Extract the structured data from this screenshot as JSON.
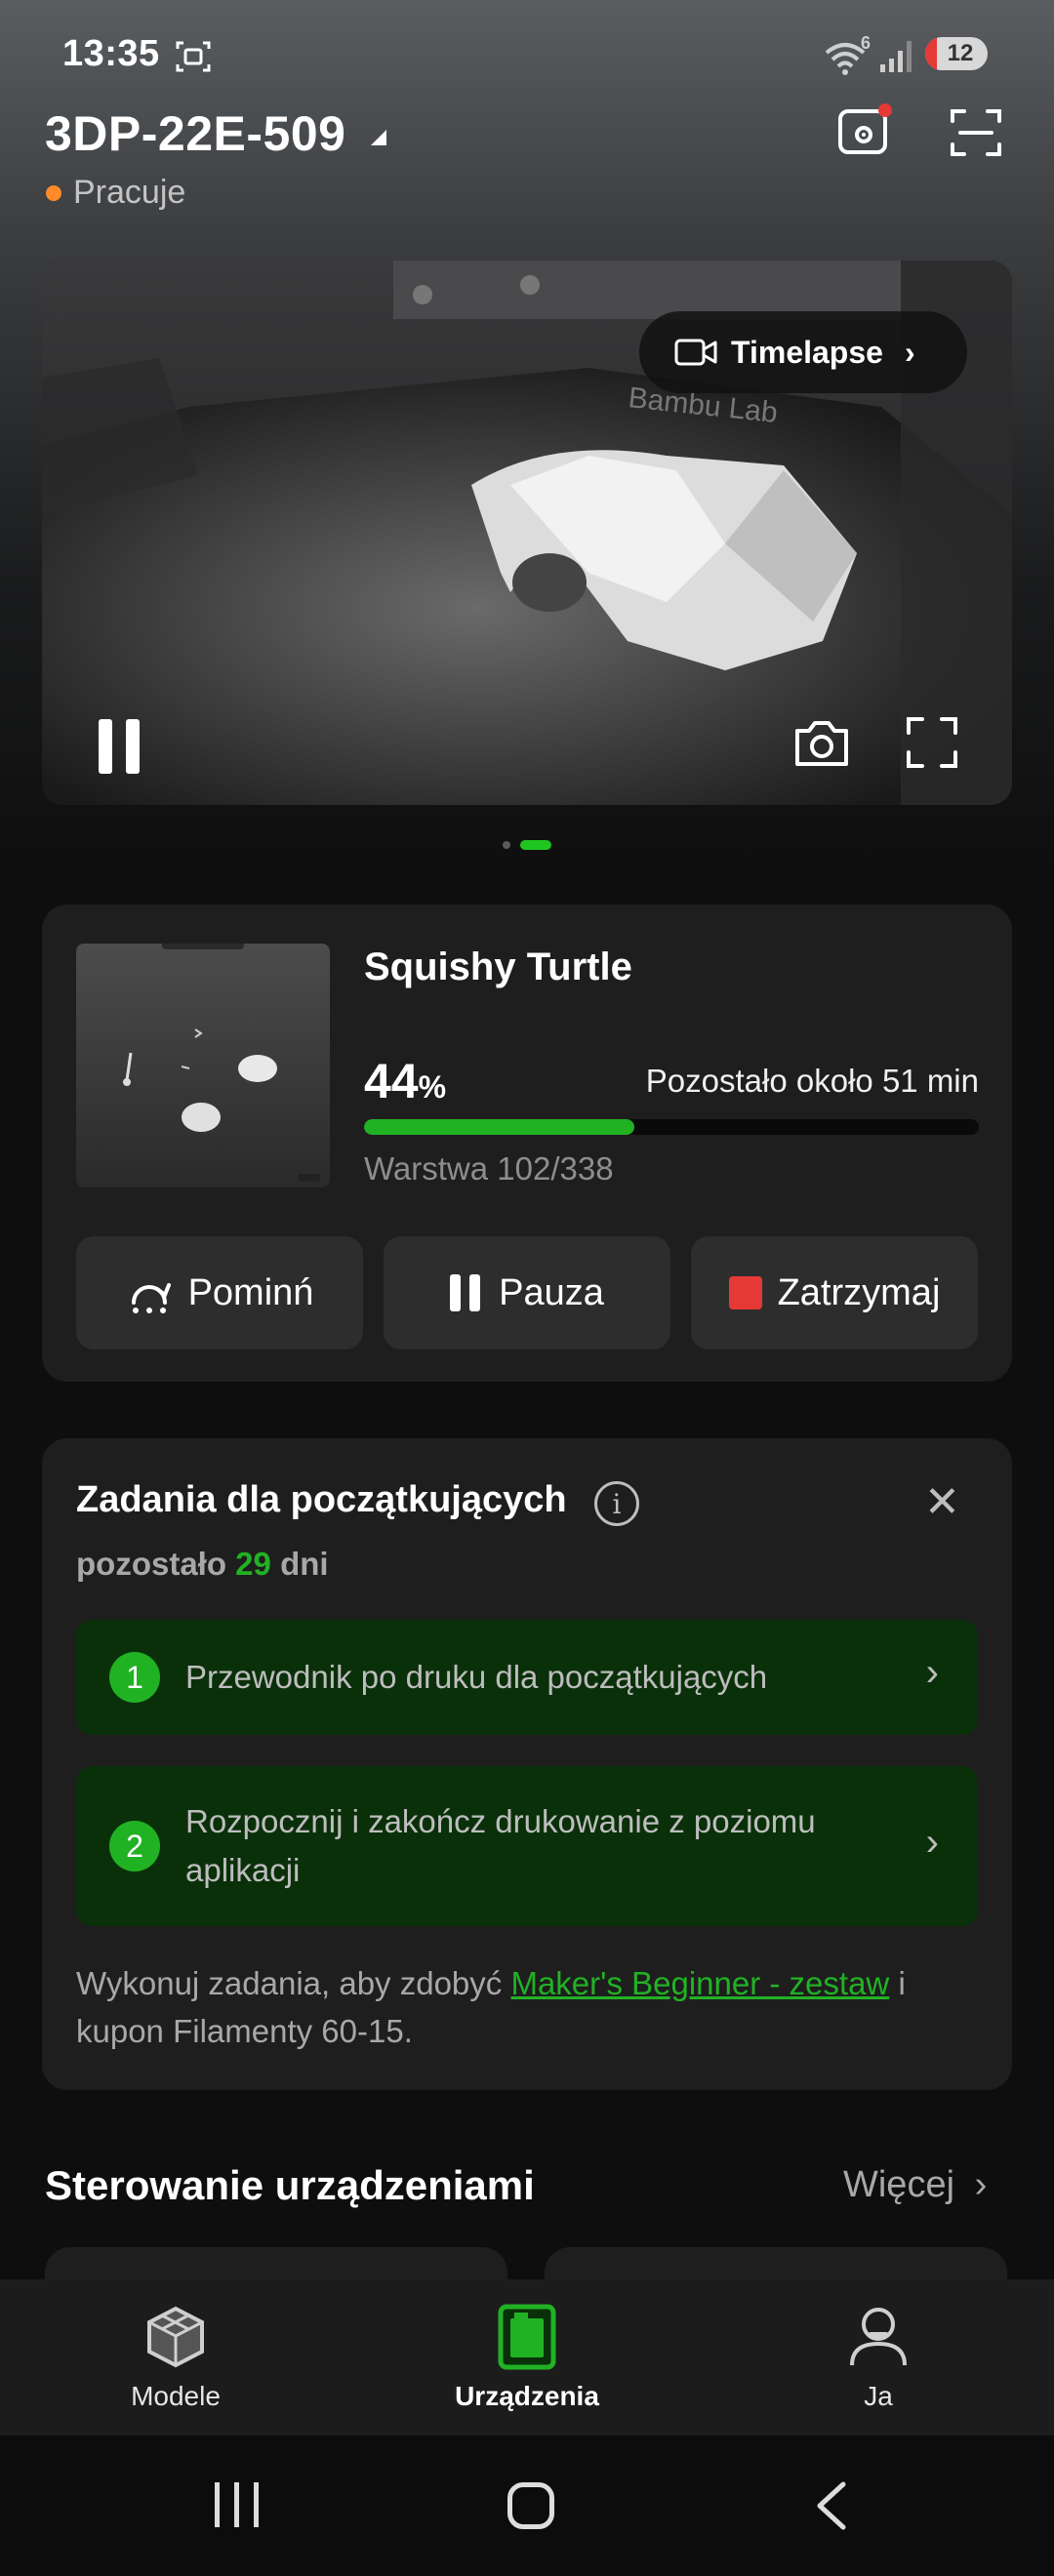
{
  "status_bar": {
    "time": "13:35",
    "network_badge": "6",
    "battery": "12",
    "icons": [
      "screen-record-icon",
      "wifi-icon",
      "signal-icon",
      "battery-icon"
    ]
  },
  "header": {
    "device_name": "3DP-22E-509",
    "status": "Pracuje",
    "status_color": "#ff8a2a",
    "icons": [
      "camera-settings-icon",
      "scan-icon"
    ]
  },
  "camera": {
    "timelapse_label": "Timelapse",
    "bed_brand_text": "Bambu Lab",
    "icons": [
      "pause-icon",
      "snapshot-icon",
      "fullscreen-icon"
    ]
  },
  "print_job": {
    "title": "Squishy Turtle",
    "progress_value": "44",
    "progress_unit": "%",
    "progress_fraction": 0.44,
    "time_remaining": "Pozostało około 51 min",
    "layer": "Warstwa 102/338",
    "buttons": {
      "skip": "Pominń",
      "pause": "Pauza",
      "stop": "Zatrzymaj"
    }
  },
  "tasks": {
    "title": "Zadania dla początkujących",
    "remaining_prefix": "pozostało",
    "remaining_days": "29",
    "remaining_suffix": "dni",
    "items": [
      {
        "number": "1",
        "label": "Przewodnik po druku dla początkujących"
      },
      {
        "number": "2",
        "label_line1": "Rozpocznij i zakończ drukowanie z poziomu",
        "label_line2": "aplikacji"
      }
    ],
    "footer_prefix": "Wykonuj zadania, aby zdobyć",
    "footer_link": "Maker's Beginner - zestaw",
    "footer_suffix_1": "i",
    "footer_suffix_2": "kupon Filamenty 60-15."
  },
  "device_control": {
    "title": "Sterowanie urządzeniami",
    "more": "Więcej"
  },
  "bottom_nav": {
    "items": [
      {
        "label": "Modele",
        "icon": "models-icon",
        "active": false
      },
      {
        "label": "Urządzenia",
        "icon": "devices-icon",
        "active": true
      },
      {
        "label": "Ja",
        "icon": "profile-icon",
        "active": false
      }
    ]
  },
  "colors": {
    "accent_green": "#21b224",
    "stop_red": "#e53935",
    "card_bg": "#1e1e1e"
  }
}
